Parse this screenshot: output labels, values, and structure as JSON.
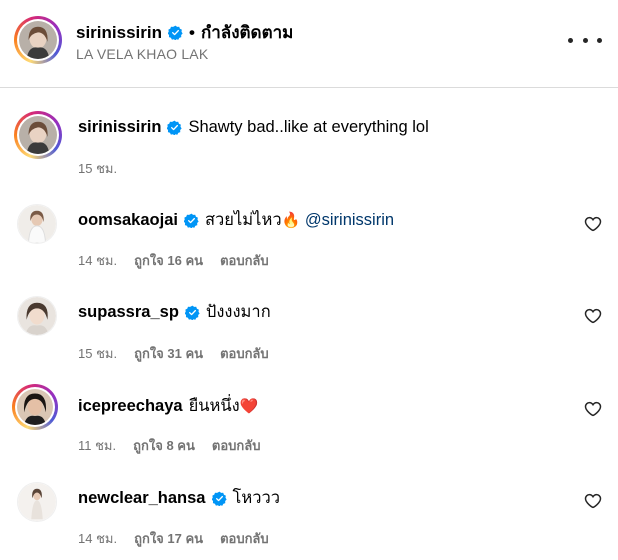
{
  "post_header": {
    "username": "sirinissirin",
    "separator": "•",
    "follow_status": "กำลังติดตาม",
    "location": "LA VELA KHAO LAK",
    "more_icon": "more-horizontal-icon"
  },
  "caption": {
    "username": "sirinissirin",
    "text": "Shawty bad..like at everything lol",
    "time": "15 ชม."
  },
  "comments": [
    {
      "username": "oomsakaojai",
      "verified": true,
      "text": "สวยไม่ไหว",
      "emoji": "🔥",
      "mention": "@sirinissirin",
      "time": "14 ชม.",
      "likes": "ถูกใจ 16 คน",
      "reply": "ตอบกลับ"
    },
    {
      "username": "supassra_sp",
      "verified": true,
      "text": "ปังงงมาก",
      "time": "15 ชม.",
      "likes": "ถูกใจ 31 คน",
      "reply": "ตอบกลับ"
    },
    {
      "username": "icepreechaya",
      "verified": false,
      "text": "ยืนหนึ่ง",
      "emoji": "❤️",
      "time": "11 ชม.",
      "likes": "ถูกใจ 8 คน",
      "reply": "ตอบกลับ"
    },
    {
      "username": "newclear_hansa",
      "verified": true,
      "text": "โหววว",
      "time": "14 ชม.",
      "likes": "ถูกใจ 17 คน",
      "reply": "ตอบกลับ"
    }
  ],
  "colors": {
    "verified_blue": "#0095f6",
    "meta_gray": "#737373",
    "mention_blue": "#00376b"
  }
}
